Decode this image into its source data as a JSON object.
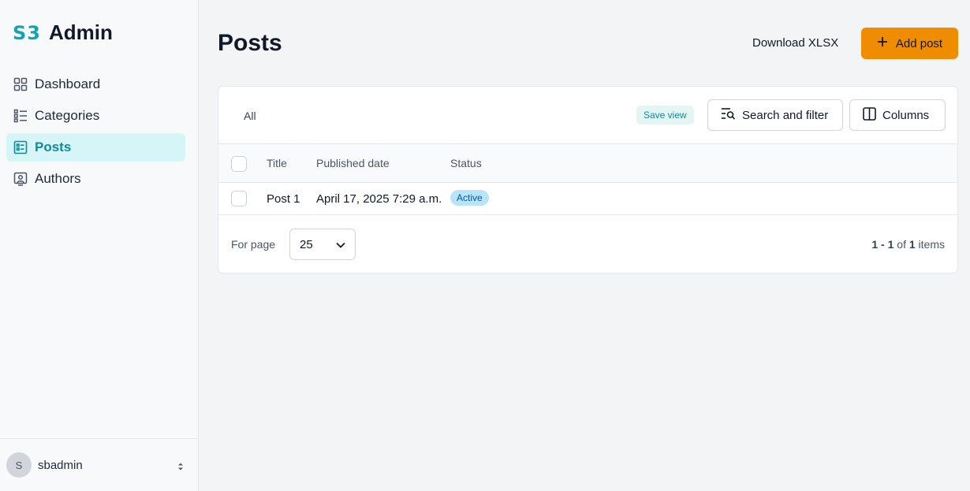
{
  "brand": {
    "logo": "S3",
    "name": "Admin",
    "accent": "#14a4b1"
  },
  "sidebar": {
    "items": [
      {
        "label": "Dashboard",
        "icon": "grid-icon"
      },
      {
        "label": "Categories",
        "icon": "list-icon"
      },
      {
        "label": "Posts",
        "icon": "posts-icon",
        "active": true
      },
      {
        "label": "Authors",
        "icon": "person-card-icon"
      }
    ],
    "user": {
      "initial": "S",
      "name": "sbadmin"
    }
  },
  "header": {
    "title": "Posts",
    "download_label": "Download XLSX",
    "add_label": "Add post",
    "add_color": "#f08c00"
  },
  "toolbar": {
    "tab_all": "All",
    "save_view": "Save view",
    "search_filter": "Search and filter",
    "columns": "Columns"
  },
  "table": {
    "headers": [
      "Title",
      "Published date",
      "Status"
    ],
    "rows": [
      {
        "title": "Post 1",
        "published": "April 17, 2025 7:29 a.m.",
        "status": "Active"
      }
    ]
  },
  "footer": {
    "per_page_label": "For page",
    "per_page_value": "25",
    "range": "1 - 1",
    "of": "of",
    "total": "1",
    "items": "items"
  }
}
